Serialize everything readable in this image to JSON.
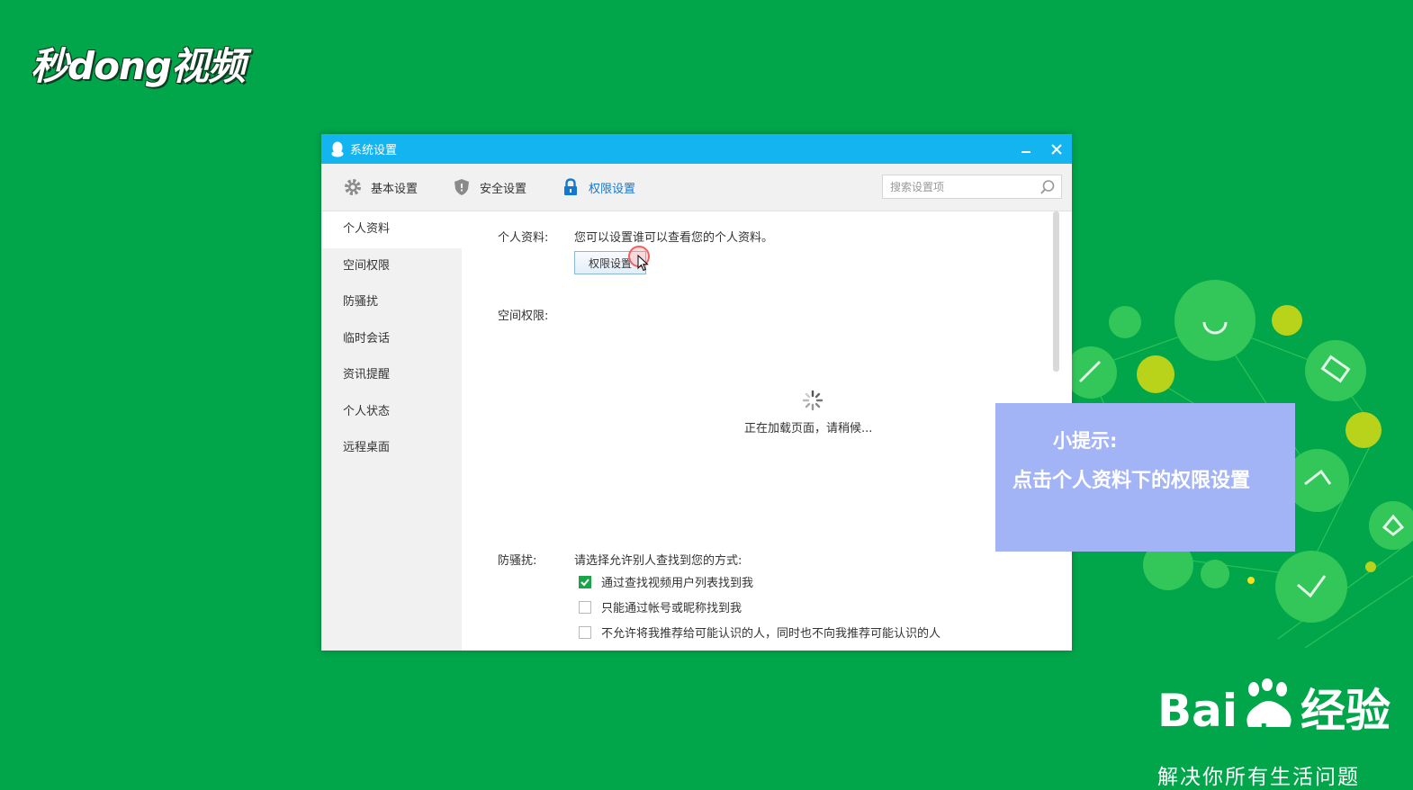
{
  "brand": {
    "logo_text": "秒dong视频"
  },
  "window": {
    "title": "系统设置",
    "minimize_label": "–",
    "close_label": "✕"
  },
  "tabs": [
    {
      "label": "基本设置",
      "icon": "gear-icon"
    },
    {
      "label": "安全设置",
      "icon": "shield-icon"
    },
    {
      "label": "权限设置",
      "icon": "lock-icon",
      "active": true
    }
  ],
  "search": {
    "placeholder": "搜索设置项"
  },
  "sidebar": {
    "items": [
      {
        "label": "个人资料",
        "active": true
      },
      {
        "label": "空间权限"
      },
      {
        "label": "防骚扰"
      },
      {
        "label": "临时会话"
      },
      {
        "label": "资讯提醒"
      },
      {
        "label": "个人状态"
      },
      {
        "label": "远程桌面"
      }
    ]
  },
  "content": {
    "profile": {
      "label": "个人资料:",
      "description": "您可以设置谁可以查看您的个人资料。",
      "button": "权限设置"
    },
    "space": {
      "label": "空间权限:",
      "loading_text": "正在加载页面，请稍候..."
    },
    "harass": {
      "label": "防骚扰:",
      "description": "请选择允许别人查找到您的方式:",
      "options": [
        {
          "label": "通过查找视频用户列表找到我",
          "checked": true
        },
        {
          "label": "只能通过帐号或昵称找到我",
          "checked": false
        },
        {
          "label": "不允许将我推荐给可能认识的人，同时也不向我推荐可能认识的人",
          "checked": false
        }
      ]
    }
  },
  "tip": {
    "title": "小提示:",
    "text": "点击个人资料下的权限设置"
  },
  "watermark": {
    "logo_left": "Bai",
    "logo_mid": "du",
    "logo_right": "经验",
    "slogan": "解决你所有生活问题"
  },
  "colors": {
    "background": "#01a54a",
    "titlebar": "#14b4f0",
    "active_tab": "#1478d2",
    "tip_box": "#a3b4f6",
    "checkbox_checked": "#1aa54a"
  }
}
